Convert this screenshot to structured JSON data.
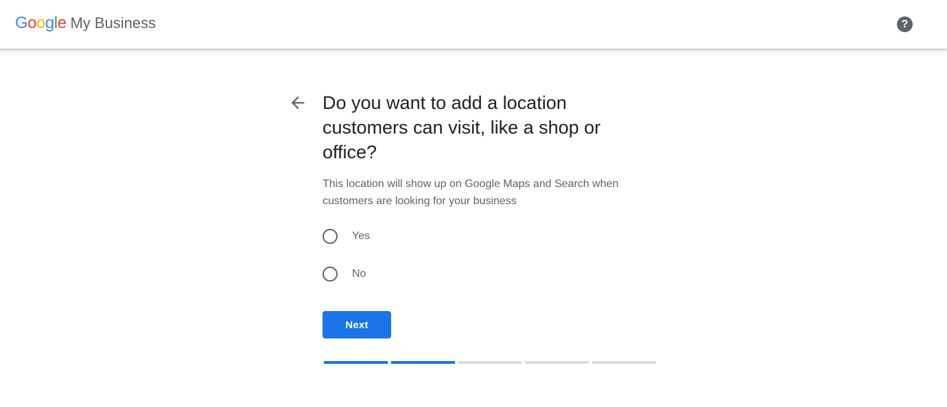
{
  "header": {
    "logo_letters": [
      {
        "char": "G",
        "color": "#4285F4"
      },
      {
        "char": "o",
        "color": "#EA4335"
      },
      {
        "char": "o",
        "color": "#FBBC05"
      },
      {
        "char": "g",
        "color": "#4285F4"
      },
      {
        "char": "l",
        "color": "#34A853"
      },
      {
        "char": "e",
        "color": "#EA4335"
      }
    ],
    "product_name": "My Business",
    "help_icon": "help-circle-icon",
    "help_symbol": "?"
  },
  "question": {
    "back_icon": "arrow-back-icon",
    "title": "Do you want to add a location customers can visit, like a shop or office?",
    "subtitle": "This location will show up on Google Maps and Search when customers are looking for your business",
    "options": [
      {
        "label": "Yes",
        "selected": false
      },
      {
        "label": "No",
        "selected": false
      }
    ],
    "next_label": "Next"
  },
  "progress": {
    "total_steps": 5,
    "completed_steps": 2
  },
  "colors": {
    "accent": "#1a73e8",
    "track": "#dadce0",
    "text_primary": "#202124",
    "text_secondary": "#5f6368"
  }
}
